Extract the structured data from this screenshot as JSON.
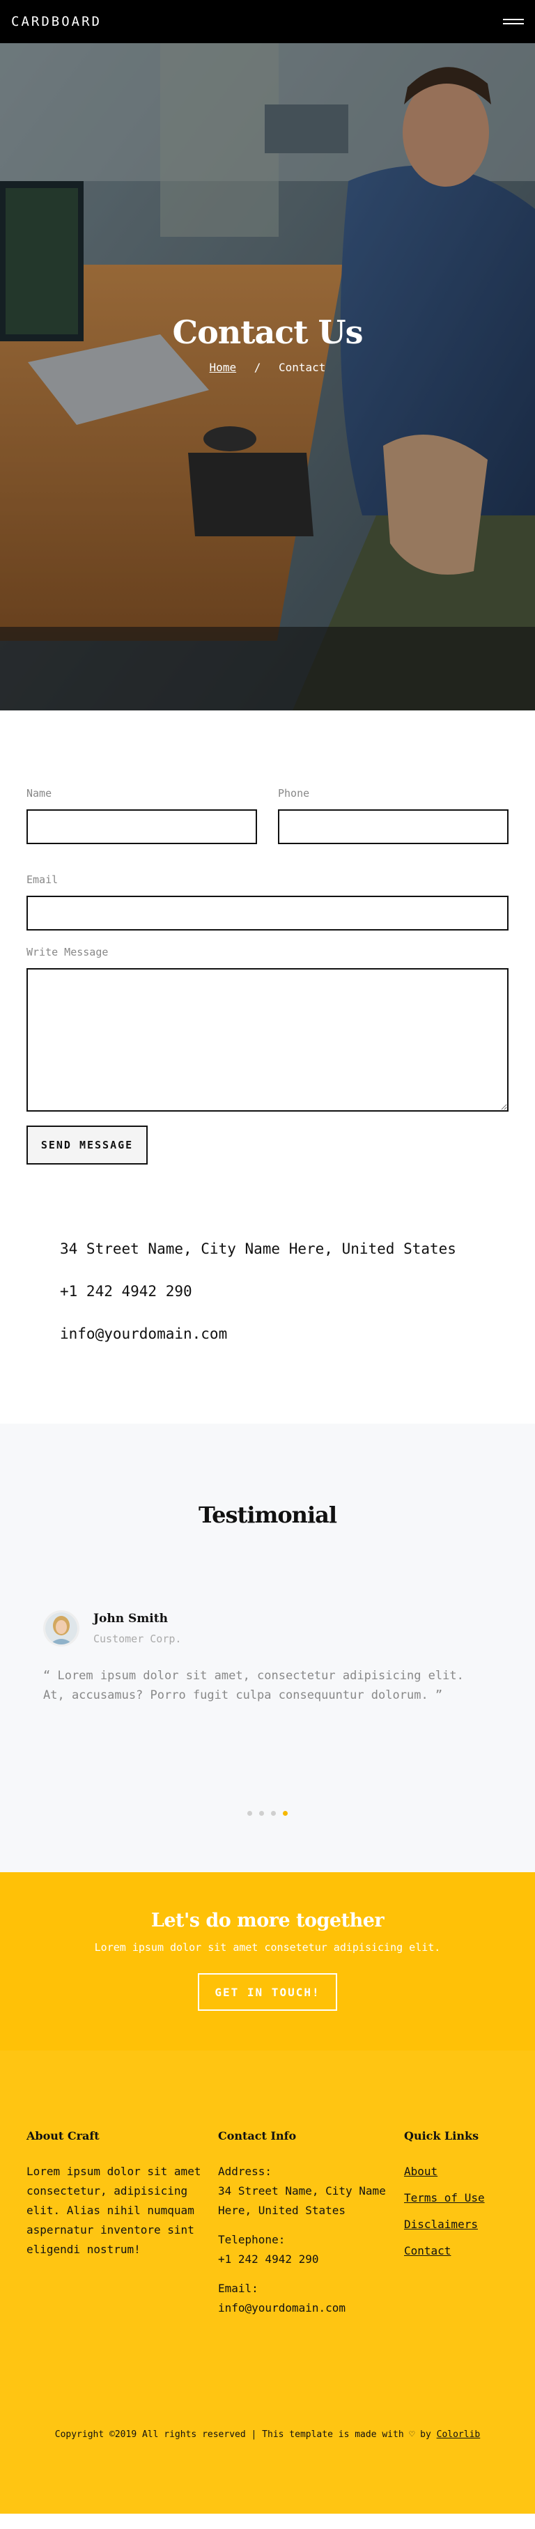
{
  "header": {
    "brand": "CARDBOARD"
  },
  "hero": {
    "title": "Contact Us",
    "breadcrumb_home": "Home",
    "breadcrumb_sep": "/",
    "breadcrumb_current": "Contact"
  },
  "form": {
    "name_label": "Name",
    "phone_label": "Phone",
    "email_label": "Email",
    "message_label": "Write Message",
    "name_value": "",
    "phone_value": "",
    "email_value": "",
    "message_value": "",
    "submit_label": "SEND MESSAGE"
  },
  "contact": {
    "address": "34 Street Name, City Name Here, United States",
    "phone": "+1 242 4942 290",
    "email": "info@yourdomain.com"
  },
  "testimonial": {
    "title": "Testimonial",
    "name": "John Smith",
    "role": "Customer Corp.",
    "quote": "“ Lorem ipsum dolor sit amet, consectetur adipisicing elit. At, accusamus? Porro fugit culpa consequuntur dolorum. ”",
    "active_slide": 4,
    "slide_count": 4
  },
  "cta": {
    "title": "Let's do more together",
    "subtitle": "Lorem ipsum dolor sit amet consetetur adipisicing elit.",
    "button": "GET IN TOUCH!"
  },
  "footer": {
    "about_title": "About Craft",
    "about_text": "Lorem ipsum dolor sit amet consectetur, adipisicing elit. Alias nihil numquam aspernatur inventore sint eligendi nostrum!",
    "contact_title": "Contact Info",
    "address_label": "Address:",
    "address": "34 Street Name, City Name Here, United States",
    "telephone_label": "Telephone:",
    "telephone": "+1 242 4942 290",
    "email_label": "Email:",
    "email": "info@yourdomain.com",
    "links_title": "Quick Links",
    "links": [
      "About",
      "Terms of Use",
      "Disclaimers",
      "Contact"
    ],
    "copyright_text": "Copyright ©2019 All rights reserved | This template is made with ♡ by",
    "copyright_link": "Colorlib"
  },
  "colors": {
    "accent": "#ffc107",
    "footer_bg": "#ffc512",
    "header_bg": "#000000",
    "active_dot": "#f6b800"
  }
}
